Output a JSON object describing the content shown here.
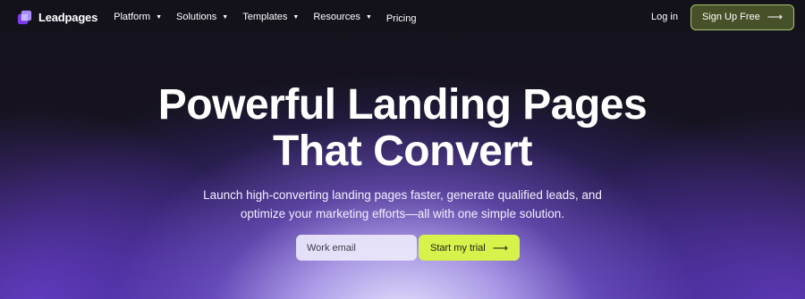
{
  "brand": {
    "name": "Leadpages",
    "logo_icon": "leadpages-logo-icon"
  },
  "nav": {
    "items": [
      {
        "label": "Platform",
        "has_dropdown": true
      },
      {
        "label": "Solutions",
        "has_dropdown": true
      },
      {
        "label": "Templates",
        "has_dropdown": true
      },
      {
        "label": "Resources",
        "has_dropdown": true
      },
      {
        "label": "Pricing",
        "has_dropdown": false
      }
    ],
    "login_label": "Log in",
    "signup_label": "Sign Up Free"
  },
  "hero": {
    "headline_line1": "Powerful Landing Pages",
    "headline_line2": "That Convert",
    "subtitle_line1": "Launch high-converting landing pages faster, generate qualified leads, and",
    "subtitle_line2": "optimize your marketing efforts—all with one simple solution.",
    "email_placeholder": "Work email",
    "cta_label": "Start my trial"
  },
  "colors": {
    "background": "#14121c",
    "signup_bg": "#46512a",
    "signup_border": "#a6c46a",
    "cta_bg": "#d7f24a",
    "glow": "#7c54e6"
  }
}
